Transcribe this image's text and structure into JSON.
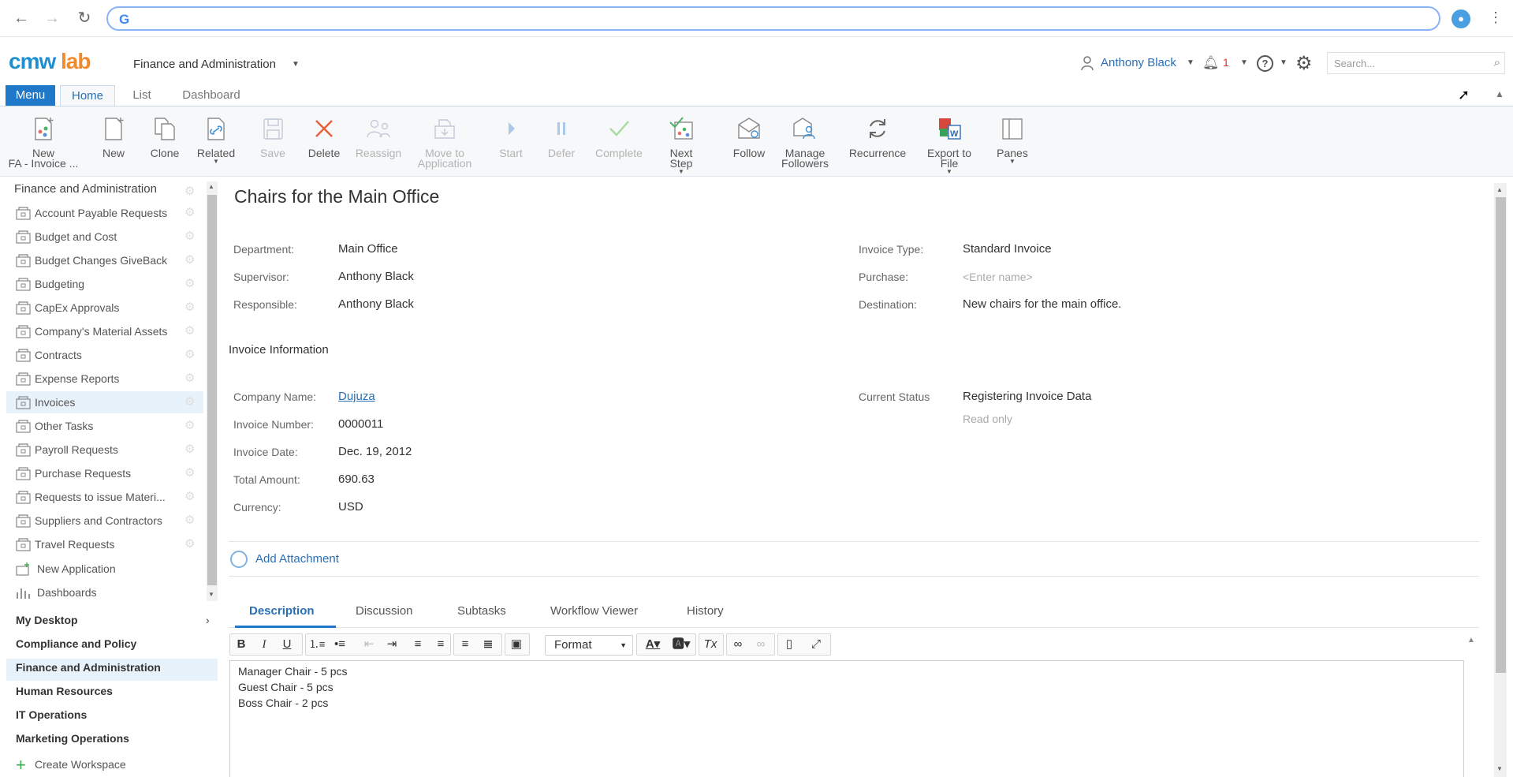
{
  "browser": {
    "omnibox_value": "",
    "google_glyph": "G"
  },
  "header": {
    "logo_part1": "cmw",
    "logo_part2": "lab",
    "workspace": "Finance and Administration",
    "user": "Anthony Black",
    "notifications": "1",
    "help_glyph": "?",
    "search_placeholder": "Search..."
  },
  "tabs": {
    "menu": "Menu",
    "items": [
      "Home",
      "List",
      "Dashboard"
    ],
    "active": "Home"
  },
  "ribbon": {
    "buttons": [
      {
        "line1": "New",
        "line2": "FA - Invoice ...",
        "disabled": false,
        "icon": "new-template-icon"
      },
      {
        "line1": "New",
        "line2": "",
        "disabled": false,
        "icon": "new-doc-icon"
      },
      {
        "line1": "Clone",
        "line2": "",
        "disabled": false,
        "icon": "clone-icon"
      },
      {
        "line1": "Related",
        "line2": "",
        "disabled": false,
        "icon": "related-icon",
        "dropdown": true
      },
      {
        "line1": "Save",
        "line2": "",
        "disabled": true,
        "icon": "save-icon"
      },
      {
        "line1": "Delete",
        "line2": "",
        "disabled": false,
        "icon": "delete-icon"
      },
      {
        "line1": "Reassign",
        "line2": "",
        "disabled": true,
        "icon": "reassign-icon"
      },
      {
        "line1": "Move to",
        "line2": "Application",
        "disabled": true,
        "icon": "move-icon"
      },
      {
        "line1": "Start",
        "line2": "",
        "disabled": true,
        "icon": "start-icon"
      },
      {
        "line1": "Defer",
        "line2": "",
        "disabled": true,
        "icon": "defer-icon"
      },
      {
        "line1": "Complete",
        "line2": "",
        "disabled": true,
        "icon": "complete-icon"
      },
      {
        "line1": "Next",
        "line2": "Step",
        "disabled": false,
        "icon": "next-step-icon",
        "dropdown": true
      },
      {
        "line1": "Follow",
        "line2": "",
        "disabled": false,
        "icon": "follow-icon"
      },
      {
        "line1": "Manage",
        "line2": "Followers",
        "disabled": false,
        "icon": "manage-followers-icon"
      },
      {
        "line1": "Recurrence",
        "line2": "",
        "disabled": false,
        "icon": "recurrence-icon"
      },
      {
        "line1": "Export to",
        "line2": "File",
        "disabled": false,
        "icon": "export-icon",
        "dropdown": true
      },
      {
        "line1": "Panes",
        "line2": "",
        "disabled": false,
        "icon": "panes-icon",
        "dropdown": true
      }
    ]
  },
  "sidebar": {
    "header": "Finance and Administration",
    "items": [
      "Account Payable Requests",
      "Budget and Cost",
      "Budget Changes GiveBack",
      "Budgeting",
      "CapEx Approvals",
      "Company's Material Assets",
      "Contracts",
      "Expense Reports",
      "Invoices",
      "Other Tasks",
      "Payroll Requests",
      "Purchase Requests",
      "Requests to issue Materi...",
      "Suppliers and Contractors",
      "Travel Requests"
    ],
    "selected": "Invoices",
    "new_application": "New Application",
    "dashboards": "Dashboards",
    "workspaces": [
      "My Desktop",
      "Compliance and Policy",
      "Finance and Administration",
      "Human Resources",
      "IT Operations",
      "Marketing Operations"
    ],
    "selected_workspace": "Finance and Administration",
    "create_workspace": "Create Workspace"
  },
  "record": {
    "title": "Chairs for the Main Office",
    "left_fields": [
      {
        "label": "Department:",
        "value": "Main Office"
      },
      {
        "label": "Supervisor:",
        "value": "Anthony Black"
      },
      {
        "label": "Responsible:",
        "value": "Anthony Black"
      }
    ],
    "right_fields": [
      {
        "label": "Invoice Type:",
        "value": "Standard Invoice"
      },
      {
        "label": "Purchase:",
        "placeholder": "<Enter name>"
      },
      {
        "label": "Destination:",
        "value": "New chairs for the main office."
      }
    ],
    "section_title": "Invoice Information",
    "invoice_fields": [
      {
        "label": "Company Name:",
        "value": "Dujuza"
      },
      {
        "label": "Invoice Number:",
        "value": "0000011"
      },
      {
        "label": "Invoice Date:",
        "value": "Dec. 19, 2012"
      },
      {
        "label": "Total Amount:",
        "value": "690.63"
      },
      {
        "label": "Currency:",
        "value": "USD"
      }
    ],
    "status_label": "Current Status",
    "status_value": "Registering Invoice Data",
    "status_note": "Read only",
    "add_attachment": "Add Attachment"
  },
  "detail_tabs": {
    "items": [
      "Description",
      "Discussion",
      "Subtasks",
      "Workflow Viewer",
      "History"
    ],
    "active": "Description"
  },
  "editor": {
    "format_label": "Format",
    "lines": [
      "Manager Chair - 5 pcs",
      "Guest Chair - 5 pcs",
      "Boss Chair - 2 pcs"
    ]
  },
  "colors": {
    "accent": "#1f78c8",
    "link": "#2a6fb5",
    "logo_blue": "#1f8fd1",
    "logo_orange": "#f08a2c",
    "alert": "#e0322c"
  }
}
